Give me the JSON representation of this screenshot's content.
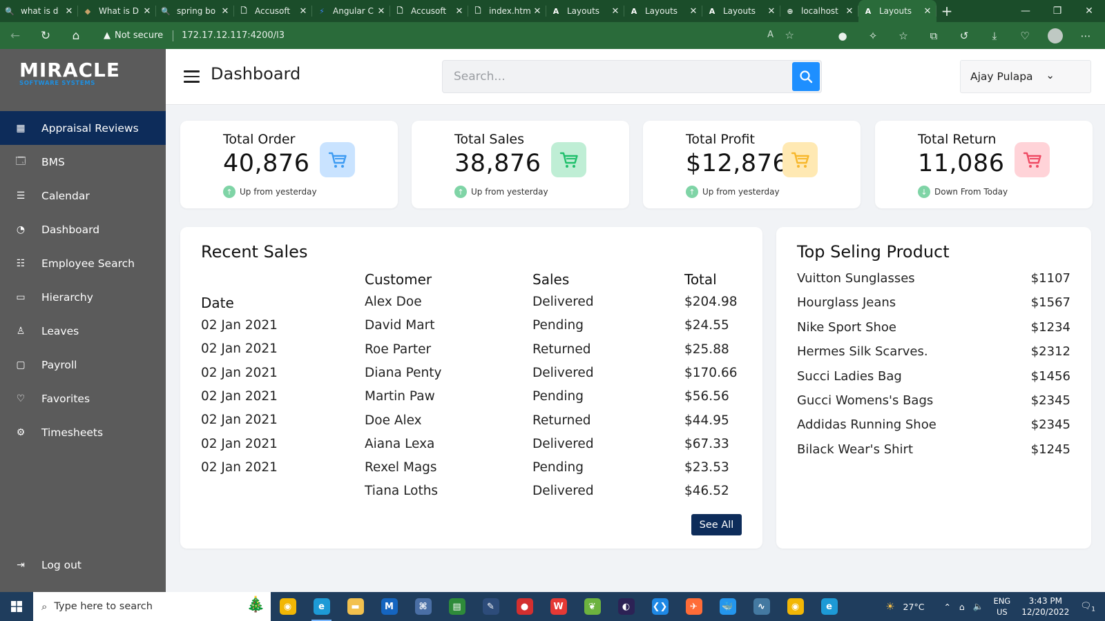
{
  "browser": {
    "tabs": [
      {
        "title": "what is d",
        "fav": "🔍",
        "fav_color": "#a7c7ff"
      },
      {
        "title": "What is D",
        "fav": "◆",
        "fav_color": "#c8a26a"
      },
      {
        "title": "spring bo",
        "fav": "🔍",
        "fav_color": "#a7c7ff"
      },
      {
        "title": "Accusoft",
        "fav": "🗋",
        "fav_color": "#e8f0ea"
      },
      {
        "title": "Angular C",
        "fav": "⚡",
        "fav_color": "#3b82f6"
      },
      {
        "title": "Accusoft",
        "fav": "🗋",
        "fav_color": "#e8f0ea"
      },
      {
        "title": "index.htm",
        "fav": "🗋",
        "fav_color": "#e8f0ea"
      },
      {
        "title": "Layouts",
        "fav": "A",
        "fav_color": "#ffffff"
      },
      {
        "title": "Layouts",
        "fav": "A",
        "fav_color": "#ffffff"
      },
      {
        "title": "Layouts",
        "fav": "A",
        "fav_color": "#ffffff"
      },
      {
        "title": "localhost",
        "fav": "⊕",
        "fav_color": "#e8f0ea"
      },
      {
        "title": "Layouts",
        "fav": "A",
        "fav_color": "#ffffff",
        "active": true
      }
    ],
    "security_label": "Not secure",
    "url": "172.17.12.117:4200/l3"
  },
  "sidebar": {
    "logo_top": "MIRACLE",
    "logo_bottom": "SOFTWARE SYSTEMS",
    "items": [
      {
        "label": "Appraisal Reviews",
        "icon": "grid-icon",
        "glyph": "▦",
        "active": true
      },
      {
        "label": "BMS",
        "icon": "inbox-icon",
        "glyph": "🗔"
      },
      {
        "label": "Calendar",
        "icon": "list-icon",
        "glyph": "☰"
      },
      {
        "label": "Dashboard",
        "icon": "pie-chart-icon",
        "glyph": "◔"
      },
      {
        "label": "Employee Search",
        "icon": "database-icon",
        "glyph": "☷"
      },
      {
        "label": "Hierarchy",
        "icon": "tablet-icon",
        "glyph": "▭"
      },
      {
        "label": "Leaves",
        "icon": "user-icon",
        "glyph": "♙"
      },
      {
        "label": "Payroll",
        "icon": "message-icon",
        "glyph": "▢"
      },
      {
        "label": "Favorites",
        "icon": "heart-icon",
        "glyph": "♡"
      },
      {
        "label": "Timesheets",
        "icon": "gear-icon",
        "glyph": "⚙"
      }
    ],
    "logout_label": "Log out"
  },
  "header": {
    "title": "Dashboard",
    "search_placeholder": "Search...",
    "user_name": "Ajay Pulapa"
  },
  "stats": [
    {
      "label": "Total Order",
      "value": "40,876",
      "trend": "Up from yesterday",
      "direction": "up",
      "icon_bg": "#c9e3ff",
      "icon_color": "#3d9bf2"
    },
    {
      "label": "Total Sales",
      "value": "38,876",
      "trend": "Up from yesterday",
      "direction": "up",
      "icon_bg": "#bfeed5",
      "icon_color": "#1fbf6b"
    },
    {
      "label": "Total Profit",
      "value": "$12,876",
      "trend": "Up from yesterday",
      "direction": "up",
      "icon_bg": "#ffe9b3",
      "icon_color": "#f7b72b"
    },
    {
      "label": "Total Return",
      "value": "11,086",
      "trend": "Down From Today",
      "direction": "down",
      "icon_bg": "#ffd3d8",
      "icon_color": "#ef4a63"
    }
  ],
  "recent_sales": {
    "title": "Recent Sales",
    "headers": {
      "date": "Date",
      "customer": "Customer",
      "sales": "Sales",
      "total": "Total"
    },
    "dates": [
      "02 Jan 2021",
      "02 Jan 2021",
      "02 Jan 2021",
      "02 Jan 2021",
      "02 Jan 2021",
      "02 Jan 2021",
      "02 Jan 2021"
    ],
    "customers": [
      "Alex Doe",
      "David Mart",
      "Roe Parter",
      "Diana Penty",
      "Martin Paw",
      "Doe Alex",
      "Aiana Lexa",
      "Rexel Mags",
      "Tiana Loths"
    ],
    "statuses": [
      "Delivered",
      "Pending",
      "Returned",
      "Delivered",
      "Pending",
      "Returned",
      "Delivered",
      "Pending",
      "Delivered"
    ],
    "totals": [
      "$204.98",
      "$24.55",
      "$25.88",
      "$170.66",
      "$56.56",
      "$44.95",
      "$67.33",
      "$23.53",
      "$46.52"
    ],
    "see_all": "See All"
  },
  "top_products": {
    "title": "Top Seling Product",
    "items": [
      {
        "name": "Vuitton Sunglasses",
        "price": "$1107"
      },
      {
        "name": "Hourglass Jeans",
        "price": "$1567"
      },
      {
        "name": "Nike Sport Shoe",
        "price": "$1234"
      },
      {
        "name": "Hermes Silk Scarves.",
        "price": "$2312"
      },
      {
        "name": "Succi Ladies Bag",
        "price": "$1456"
      },
      {
        "name": "Gucci Womens's Bags",
        "price": "$2345"
      },
      {
        "name": "Addidas Running Shoe",
        "price": "$2345"
      },
      {
        "name": "Bilack Wear's Shirt",
        "price": "$1245"
      }
    ]
  },
  "taskbar": {
    "search_placeholder": "Type here to search",
    "apps": [
      {
        "name": "chrome-icon",
        "color": "#f2b705",
        "glyph": "◉"
      },
      {
        "name": "edge-icon",
        "color": "#1d9ad6",
        "glyph": "e",
        "active": true
      },
      {
        "name": "file-explorer-icon",
        "color": "#f2c14e",
        "glyph": "▬"
      },
      {
        "name": "mail-icon",
        "color": "#1565c0",
        "glyph": "M"
      },
      {
        "name": "network-tool-icon",
        "color": "#4a6fa5",
        "glyph": "⌘"
      },
      {
        "name": "spreadsheet-icon",
        "color": "#2e8b3a",
        "glyph": "▤"
      },
      {
        "name": "dev-tool-icon",
        "color": "#2d4c7a",
        "glyph": "✎"
      },
      {
        "name": "recorder-icon",
        "color": "#d32f2f",
        "glyph": "●"
      },
      {
        "name": "office-icon",
        "color": "#e53935",
        "glyph": "W"
      },
      {
        "name": "spring-icon",
        "color": "#6db33f",
        "glyph": "❦"
      },
      {
        "name": "eclipse-icon",
        "color": "#2c2255",
        "glyph": "◐"
      },
      {
        "name": "vscode-icon",
        "color": "#1e88e5",
        "glyph": "❮❯"
      },
      {
        "name": "postman-icon",
        "color": "#ff6c37",
        "glyph": "✈"
      },
      {
        "name": "docker-icon",
        "color": "#2496ed",
        "glyph": "🐳"
      },
      {
        "name": "mysql-icon",
        "color": "#4479a1",
        "glyph": "∿"
      },
      {
        "name": "chrome-user-icon",
        "color": "#f2b705",
        "glyph": "◉"
      },
      {
        "name": "edge-user-icon",
        "color": "#1d9ad6",
        "glyph": "e"
      }
    ],
    "weather": "27°C",
    "lang_top": "ENG",
    "lang_bottom": "US",
    "time": "3:43 PM",
    "date": "12/20/2022",
    "notification_count": "1"
  }
}
